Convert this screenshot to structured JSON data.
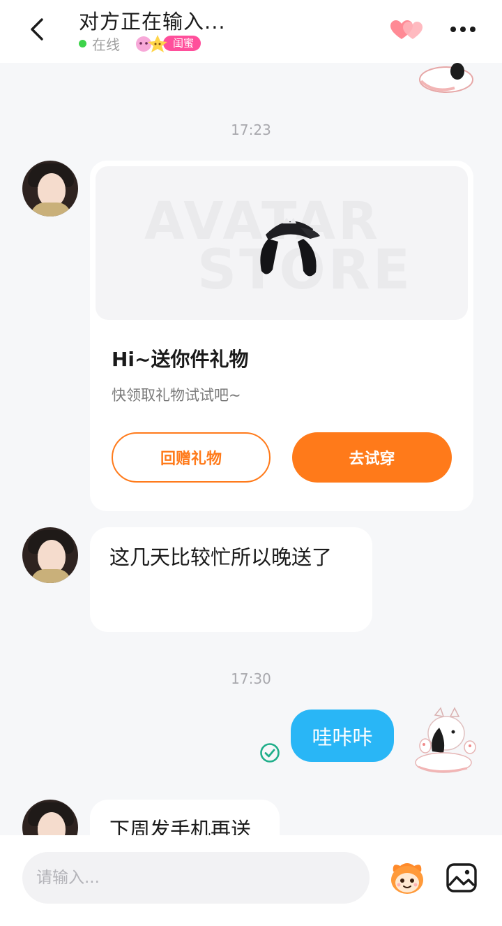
{
  "header": {
    "back_icon": "chevron-left-icon",
    "title": "对方正在输入...",
    "status": "在线",
    "relation_badge": "闺蜜",
    "hearts_icon": "double-heart-icon",
    "more_icon": "more-horizontal-icon",
    "colors": {
      "online": "#3dd34a",
      "badge": "#ff4f9b",
      "hearts": "#ff8a95"
    }
  },
  "messages": {
    "time_1": "17:23",
    "gift": {
      "image_watermark_top": "AVATAR",
      "image_watermark_bottom": "STORE",
      "title": "Hi~送你件礼物",
      "subtitle": "快领取礼物试试吧~",
      "return_gift_label": "回赠礼物",
      "try_on_label": "去试穿"
    },
    "msg_1": "这几天比较忙所以晚送了",
    "time_2": "17:30",
    "msg_self": "哇咔咔",
    "msg_2": "下周发手机再送"
  },
  "footer": {
    "input_placeholder": "请输入...",
    "emoji_icon": "emoji-mascot-icon",
    "image_icon": "image-icon"
  },
  "colors": {
    "accent": "#ff7a1a",
    "self_bubble": "#29b6f6",
    "read_check": "#1fae8a",
    "background": "#f6f7f9"
  }
}
